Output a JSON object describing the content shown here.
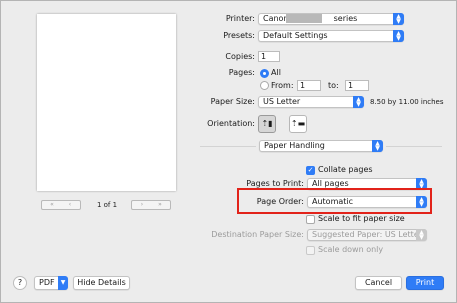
{
  "preview": {
    "page_indicator": "1 of 1",
    "nav_buttons": {
      "first": "«",
      "prev": "‹",
      "next": "›",
      "last": "»"
    }
  },
  "form": {
    "printer": {
      "label": "Printer:",
      "value_prefix": "Canon",
      "value_suffix": "series"
    },
    "presets": {
      "label": "Presets:",
      "value": "Default Settings"
    },
    "copies": {
      "label": "Copies:",
      "value": "1"
    },
    "pages": {
      "label": "Pages:",
      "all_label": "All",
      "from_label": "From:",
      "from_value": "1",
      "to_label": "to:",
      "to_value": "1"
    },
    "paper_size": {
      "label": "Paper Size:",
      "value": "US Letter",
      "dimensions": "8.50 by 11.00 inches"
    },
    "orientation": {
      "label": "Orientation:"
    },
    "section": {
      "value": "Paper Handling"
    },
    "collate": {
      "label": "Collate pages",
      "checked": true
    },
    "pages_to_print": {
      "label": "Pages to Print:",
      "value": "All pages"
    },
    "page_order": {
      "label": "Page Order:",
      "value": "Automatic"
    },
    "scale_to_fit": {
      "label": "Scale to fit paper size",
      "checked": false
    },
    "destination_paper_size": {
      "label": "Destination Paper Size:",
      "value": "Suggested Paper: US Letter"
    },
    "scale_down_only": {
      "label": "Scale down only",
      "checked": false
    }
  },
  "footer": {
    "help": "?",
    "pdf": "PDF",
    "hide_details": "Hide Details",
    "cancel": "Cancel",
    "print": "Print"
  },
  "colors": {
    "accent": "#2f7cf6",
    "highlight": "#e2231a",
    "background": "#ececec"
  }
}
